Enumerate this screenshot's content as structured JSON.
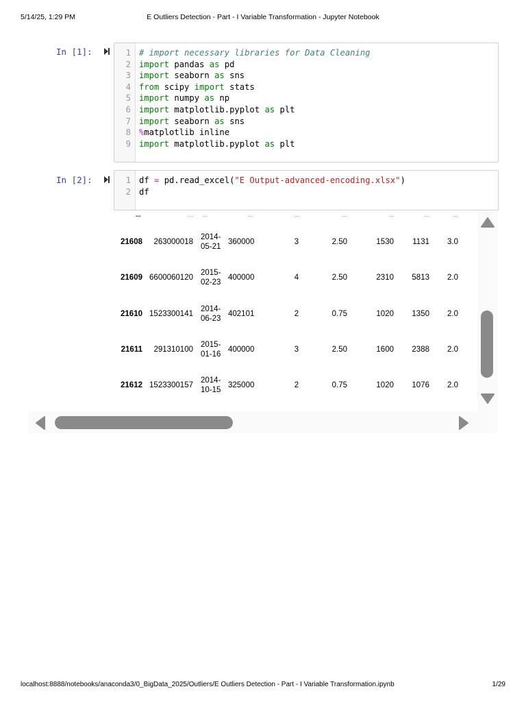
{
  "header": {
    "datetime": "5/14/25, 1:29 PM",
    "title": "E Outliers Detection - Part - I Variable Transformation - Jupyter Notebook"
  },
  "footer": {
    "url": "localhost:8888/notebooks/anaconda3/0_BigData_2025/Outliers/E Outliers Detection - Part - I Variable Transformation.ipynb",
    "page": "1/29"
  },
  "cells": [
    {
      "prompt": "In [1]:",
      "lines": [
        [
          {
            "t": "# import necessary libraries for Data Cleaning",
            "c": "cm"
          }
        ],
        [
          {
            "t": "import",
            "c": "kw"
          },
          {
            "t": " pandas "
          },
          {
            "t": "as",
            "c": "kw"
          },
          {
            "t": " pd"
          }
        ],
        [
          {
            "t": "import",
            "c": "kw"
          },
          {
            "t": " seaborn "
          },
          {
            "t": "as",
            "c": "kw"
          },
          {
            "t": " sns"
          }
        ],
        [
          {
            "t": "from",
            "c": "kw"
          },
          {
            "t": " scipy "
          },
          {
            "t": "import",
            "c": "kw"
          },
          {
            "t": " stats"
          }
        ],
        [
          {
            "t": "import",
            "c": "kw"
          },
          {
            "t": " numpy "
          },
          {
            "t": "as",
            "c": "kw"
          },
          {
            "t": " np"
          }
        ],
        [
          {
            "t": "import",
            "c": "kw"
          },
          {
            "t": " matplotlib.pyplot "
          },
          {
            "t": "as",
            "c": "kw"
          },
          {
            "t": " plt"
          }
        ],
        [
          {
            "t": "import",
            "c": "kw"
          },
          {
            "t": " seaborn "
          },
          {
            "t": "as",
            "c": "kw"
          },
          {
            "t": " sns"
          }
        ],
        [
          {
            "t": "%",
            "c": "op"
          },
          {
            "t": "matplotlib inline"
          }
        ],
        [
          {
            "t": "import",
            "c": "kw"
          },
          {
            "t": " matplotlib.pyplot "
          },
          {
            "t": "as",
            "c": "kw"
          },
          {
            "t": " plt"
          }
        ]
      ]
    },
    {
      "prompt": "In [2]:",
      "lines": [
        [
          {
            "t": "df "
          },
          {
            "t": "=",
            "c": "op"
          },
          {
            "t": " pd.read_excel("
          },
          {
            "t": "\"E Output-advanced-encoding.xlsx\"",
            "c": "st"
          },
          {
            "t": ")"
          }
        ],
        [
          {
            "t": "df"
          }
        ]
      ]
    }
  ],
  "table": {
    "ellipsis_row": [
      "...",
      "...",
      "...",
      "...",
      "...",
      "...",
      "...",
      "...",
      "..."
    ],
    "rows": [
      {
        "index": "21608",
        "id": "263000018",
        "date": [
          "2014-",
          "05-21"
        ],
        "price": "360000",
        "bedrooms": "3",
        "bathrooms": "2.50",
        "sqft_living": "1530",
        "sqft_lot": "1131",
        "floors": "3.0"
      },
      {
        "index": "21609",
        "id": "6600060120",
        "date": [
          "2015-",
          "02-23"
        ],
        "price": "400000",
        "bedrooms": "4",
        "bathrooms": "2.50",
        "sqft_living": "2310",
        "sqft_lot": "5813",
        "floors": "2.0"
      },
      {
        "index": "21610",
        "id": "1523300141",
        "date": [
          "2014-",
          "06-23"
        ],
        "price": "402101",
        "bedrooms": "2",
        "bathrooms": "0.75",
        "sqft_living": "1020",
        "sqft_lot": "1350",
        "floors": "2.0"
      },
      {
        "index": "21611",
        "id": "291310100",
        "date": [
          "2015-",
          "01-16"
        ],
        "price": "400000",
        "bedrooms": "3",
        "bathrooms": "2.50",
        "sqft_living": "1600",
        "sqft_lot": "2388",
        "floors": "2.0"
      },
      {
        "index": "21612",
        "id": "1523300157",
        "date": [
          "2014-",
          "10-15"
        ],
        "price": "325000",
        "bedrooms": "2",
        "bathrooms": "0.75",
        "sqft_living": "1020",
        "sqft_lot": "1076",
        "floors": "2.0"
      }
    ]
  }
}
